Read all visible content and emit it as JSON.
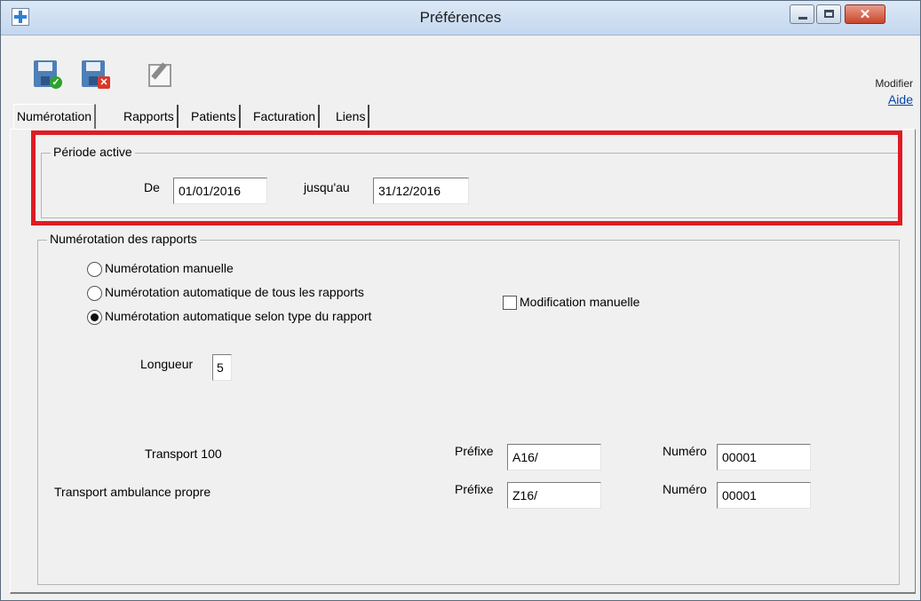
{
  "window": {
    "title": "Préférences",
    "close_symbol": "✕"
  },
  "toolbar": {
    "modify_label": "Modifier",
    "help_link": "Aide"
  },
  "tabs": [
    {
      "label": "Numérotation"
    },
    {
      "label": "Rapports"
    },
    {
      "label": "Patients"
    },
    {
      "label": "Facturation"
    },
    {
      "label": "Liens"
    }
  ],
  "period": {
    "legend": "Période active",
    "from_label": "De",
    "from_value": "01/01/2016",
    "to_label": "jusqu'au",
    "to_value": "31/12/2016"
  },
  "numbering": {
    "legend": "Numérotation des rapports",
    "options": [
      {
        "label": "Numérotation manuelle",
        "checked": false
      },
      {
        "label": "Numérotation automatique de tous les rapports",
        "checked": false
      },
      {
        "label": "Numérotation automatique selon type du rapport",
        "checked": true
      }
    ],
    "manual_edit_label": "Modification manuelle",
    "length_label": "Longueur",
    "length_value": "5",
    "rows": [
      {
        "name": "Transport 100",
        "prefix_label": "Préfixe",
        "prefix_value": "A16/",
        "number_label": "Numéro",
        "number_value": "00001"
      },
      {
        "name": "Transport ambulance propre",
        "prefix_label": "Préfixe",
        "prefix_value": "Z16/",
        "number_label": "Numéro",
        "number_value": "00001"
      }
    ]
  },
  "colors": {
    "highlight": "#e01b24",
    "link": "#0645ad"
  }
}
